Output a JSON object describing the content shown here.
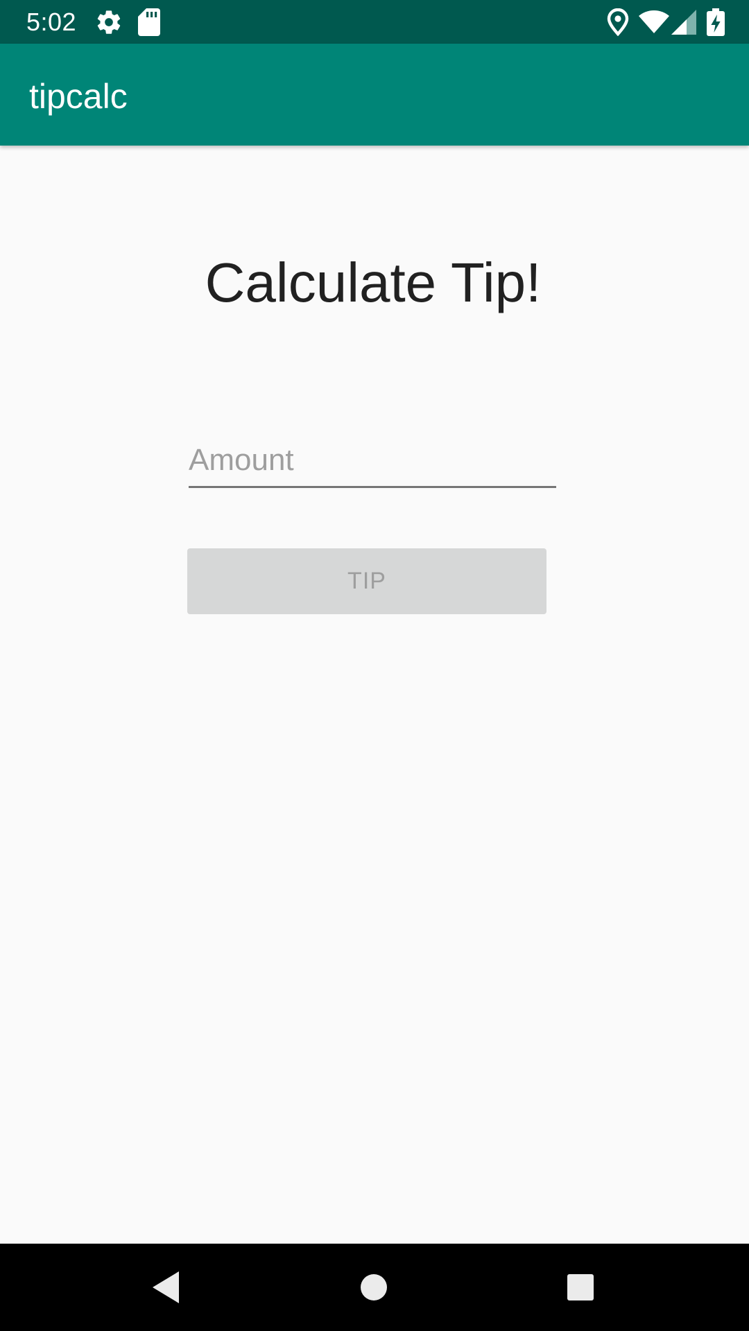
{
  "status_bar": {
    "time": "5:02",
    "left_icons": [
      "settings-icon",
      "sd-card-icon"
    ],
    "right_icons": [
      "location-icon",
      "wifi-icon",
      "cell-signal-icon",
      "battery-charging-icon"
    ]
  },
  "app_bar": {
    "title": "tipcalc",
    "color": "#008577"
  },
  "main": {
    "heading": "Calculate Tip!",
    "amount_field": {
      "placeholder": "Amount",
      "value": ""
    },
    "tip_button": {
      "label": "TIP",
      "enabled": false
    }
  },
  "nav_bar": {
    "buttons": [
      "back-icon",
      "home-icon",
      "recents-icon"
    ]
  },
  "colors": {
    "status_bar": "#00594f",
    "app_bar": "#008577",
    "background": "#fafafa",
    "button_disabled": "#d6d7d7",
    "nav_bar": "#000000"
  }
}
